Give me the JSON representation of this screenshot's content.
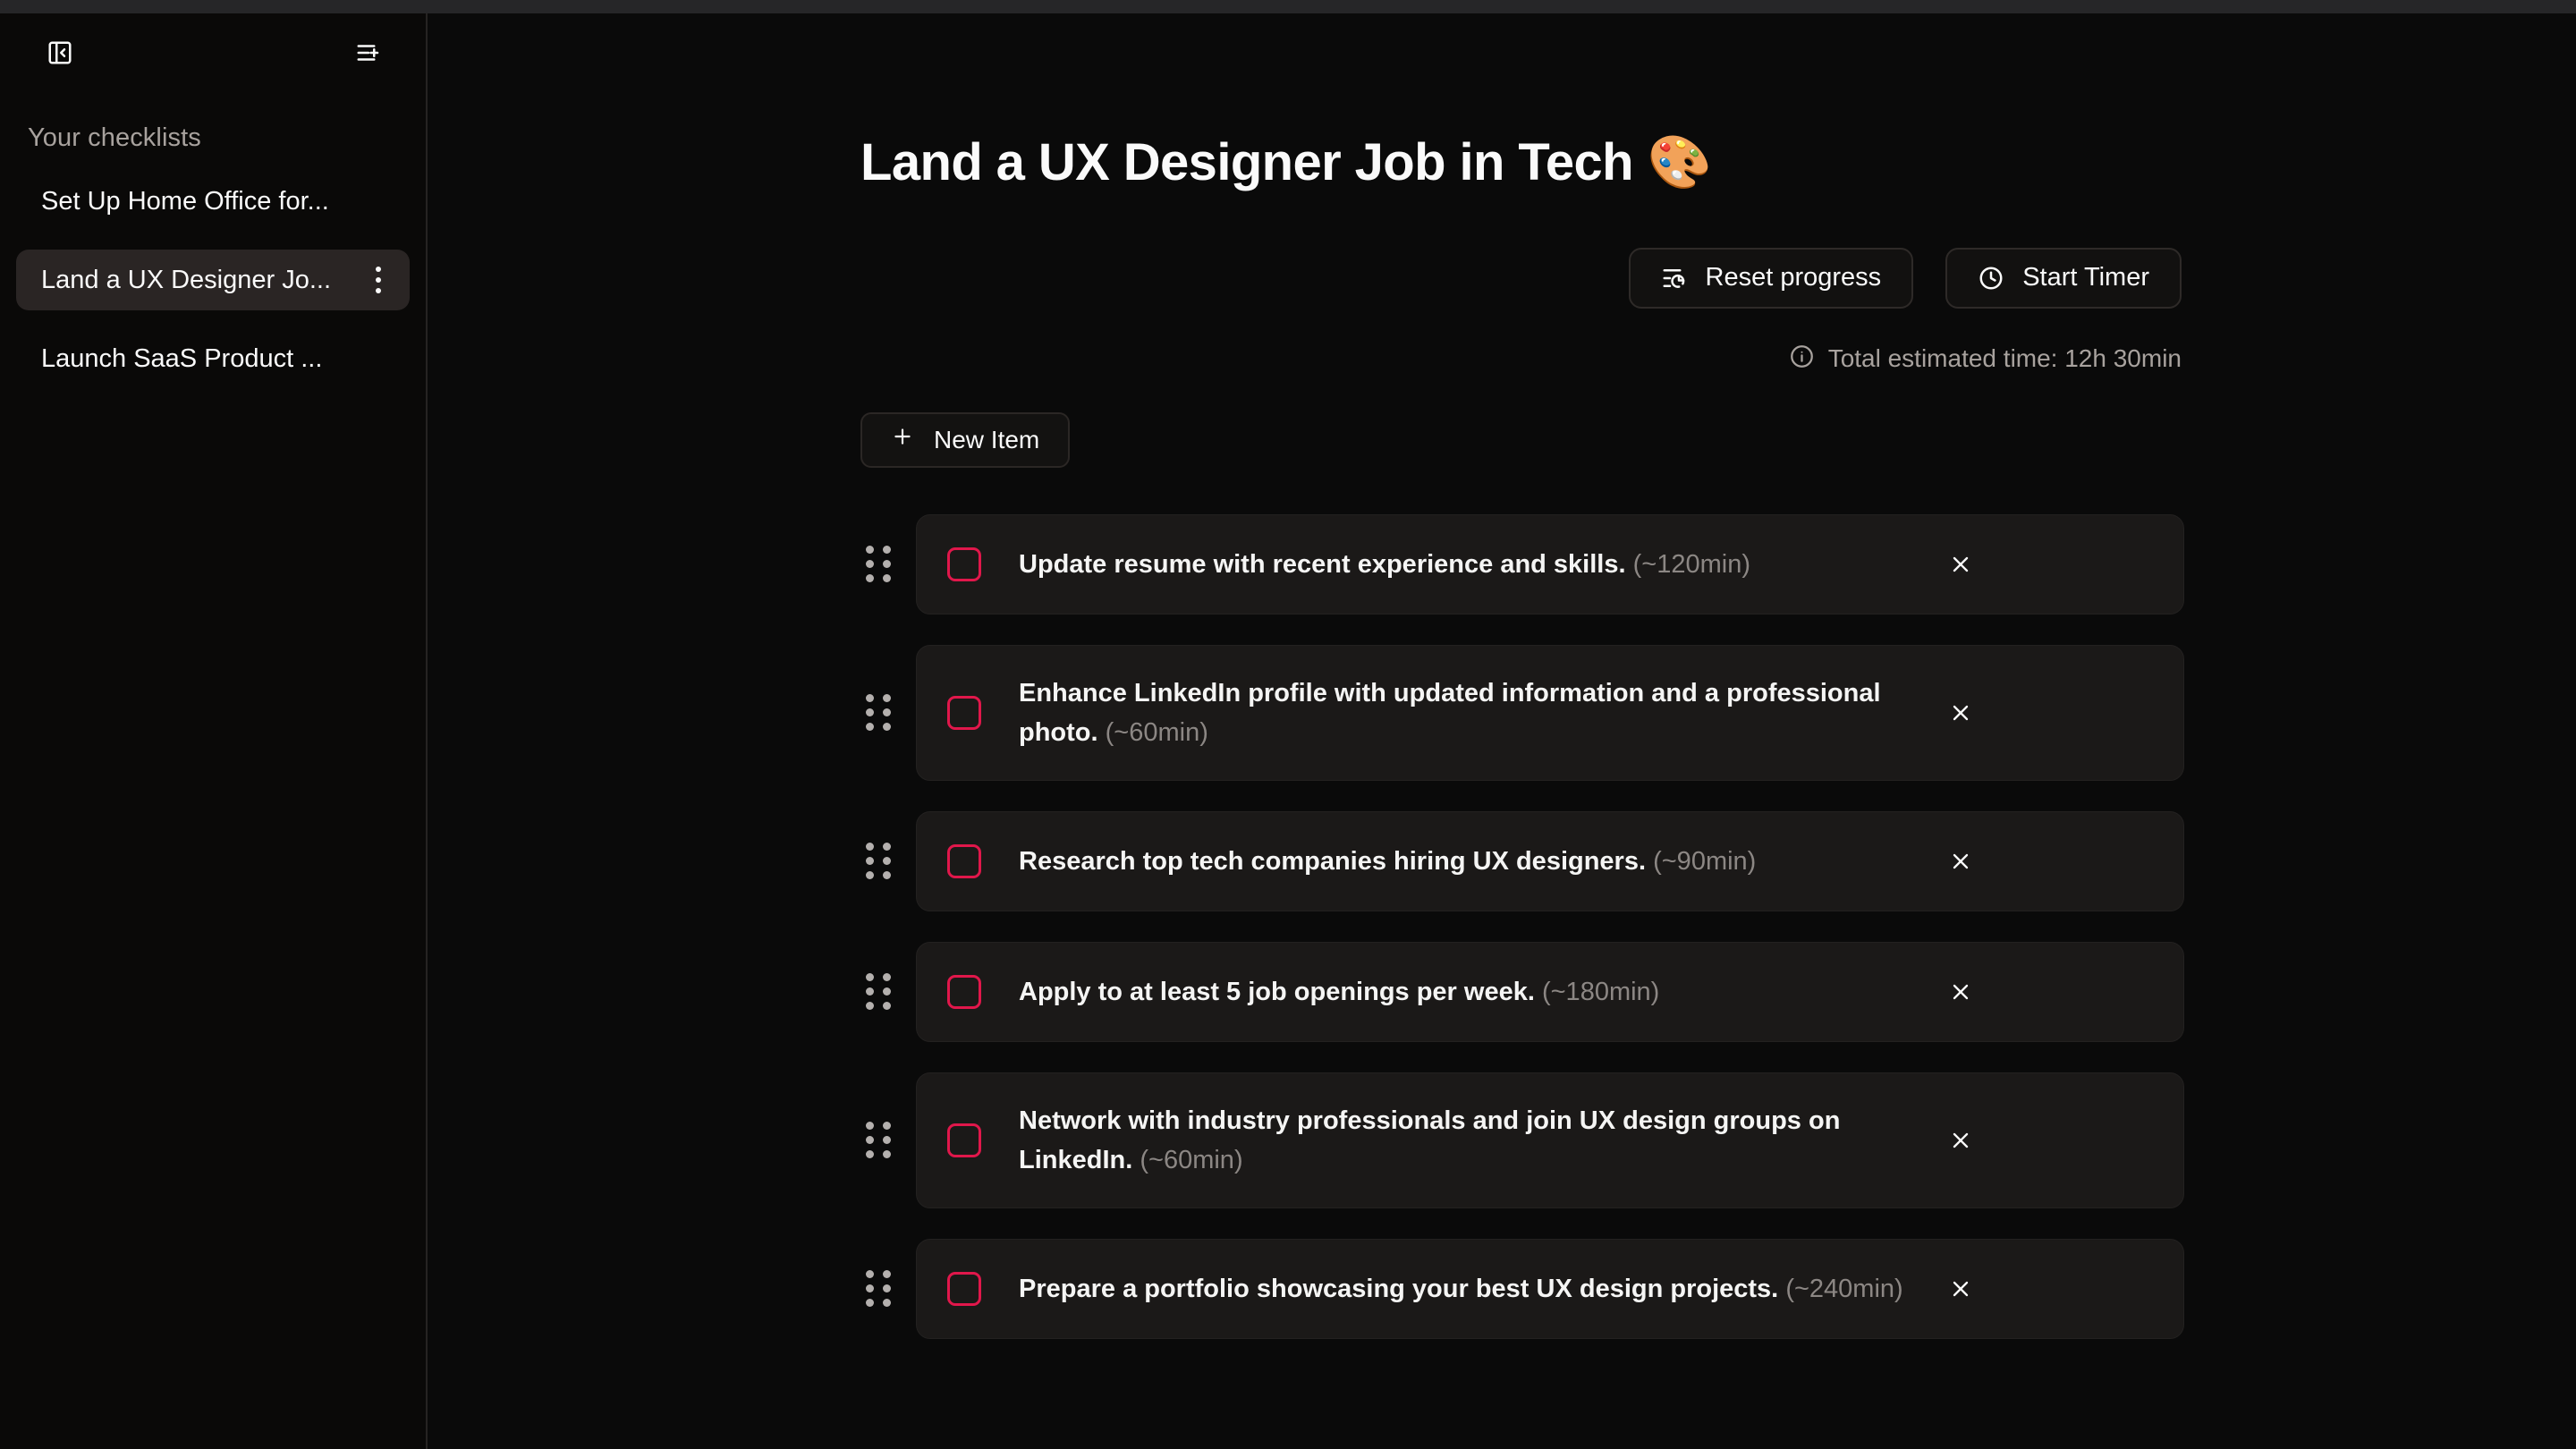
{
  "sidebar": {
    "collapse_icon": "panel-left-close-icon",
    "new_list_icon": "list-plus-icon",
    "section_title": "Your checklists",
    "items": [
      {
        "label": "Set Up Home Office for...",
        "active": false
      },
      {
        "label": "Land a UX Designer Jo...",
        "active": true
      },
      {
        "label": "Launch SaaS Product ...",
        "active": false
      }
    ]
  },
  "main": {
    "title": "Land a UX Designer Job in Tech 🎨",
    "reset_label": "Reset progress",
    "timer_label": "Start Timer",
    "estimate_label": "Total estimated time: 12h 30min",
    "new_item_label": "New Item",
    "checkbox_color": "#e1174b",
    "items": [
      {
        "text": "Update resume with recent experience and skills.",
        "estimate": "(~120min)",
        "checked": false,
        "lines": 1
      },
      {
        "text": "Enhance LinkedIn profile with updated information and a professional photo.",
        "estimate": "(~60min)",
        "checked": false,
        "lines": 2
      },
      {
        "text": "Research top tech companies hiring UX designers.",
        "estimate": "(~90min)",
        "checked": false,
        "lines": 1
      },
      {
        "text": "Apply to at least 5 job openings per week.",
        "estimate": "(~180min)",
        "checked": false,
        "lines": 1
      },
      {
        "text": "Network with industry professionals and join UX design groups on LinkedIn.",
        "estimate": "(~60min)",
        "checked": false,
        "lines": 2
      },
      {
        "text": "Prepare a portfolio showcasing your best UX design projects.",
        "estimate": "(~240min)",
        "checked": false,
        "lines": 1
      }
    ]
  }
}
